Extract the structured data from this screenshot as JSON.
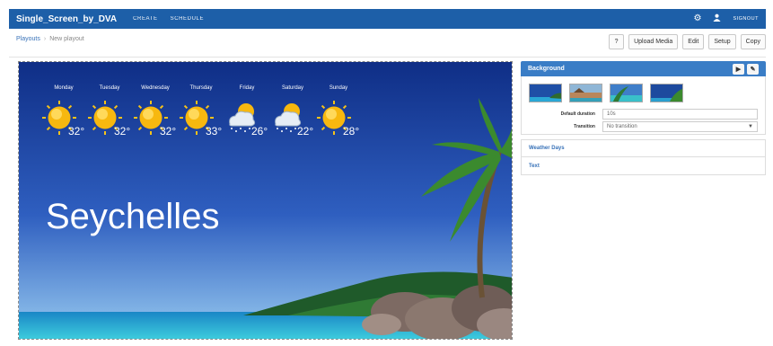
{
  "topbar": {
    "brand": "Single_Screen_by_DVA",
    "nav": [
      "CREATE",
      "SCHEDULE"
    ],
    "signout": "SIGNOUT"
  },
  "breadcrumb": {
    "root": "Playouts",
    "separator": "›",
    "current": "New playout"
  },
  "toolbar": {
    "help": "?",
    "upload": "Upload Media",
    "edit": "Edit",
    "setup": "Setup",
    "copy": "Copy"
  },
  "canvas": {
    "location": "Seychelles",
    "forecast": [
      {
        "day": "Monday",
        "icon": "sun-icon",
        "temp": "32°"
      },
      {
        "day": "Tuesday",
        "icon": "sun-icon",
        "temp": "32°"
      },
      {
        "day": "Wednesday",
        "icon": "sun-icon",
        "temp": "32°"
      },
      {
        "day": "Thursday",
        "icon": "sun-icon",
        "temp": "33°"
      },
      {
        "day": "Friday",
        "icon": "sun-cloud-rain-icon",
        "temp": "26°"
      },
      {
        "day": "Saturday",
        "icon": "sun-cloud-rain-icon",
        "temp": "22°"
      },
      {
        "day": "Sunday",
        "icon": "sun-icon",
        "temp": "28°"
      }
    ]
  },
  "panel": {
    "background_title": "Background",
    "default_duration_label": "Default duration",
    "default_duration_value": "10s",
    "transition_label": "Transition",
    "transition_value": "No transition",
    "sections": [
      "Weather Days",
      "Text"
    ]
  },
  "colors": {
    "brand": "#1d5fa8",
    "panel_header": "#3a7dc6",
    "link": "#3872b8"
  }
}
